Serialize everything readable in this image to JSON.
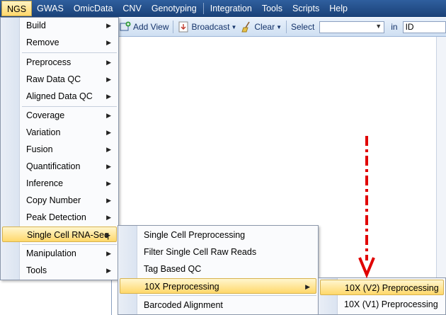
{
  "menubar": {
    "items": [
      "NGS",
      "GWAS",
      "OmicData",
      "CNV",
      "Genotyping",
      "Integration",
      "Tools",
      "Scripts",
      "Help"
    ]
  },
  "toolbar": {
    "add_view": "Add View",
    "broadcast": "Broadcast",
    "clear": "Clear",
    "select_label": "Select",
    "select_value": "",
    "in_label": "in",
    "in_value": "ID"
  },
  "ngs_menu": {
    "items": [
      "Build",
      "Remove",
      "Preprocess",
      "Raw Data QC",
      "Aligned Data QC",
      "Coverage",
      "Variation",
      "Fusion",
      "Quantification",
      "Inference",
      "Copy Number",
      "Peak Detection",
      "Single Cell RNA-Seq",
      "Manipulation",
      "Tools"
    ]
  },
  "scrna_menu": {
    "items": [
      "Single Cell Preprocessing",
      "Filter Single Cell Raw Reads",
      "Tag Based QC",
      "10X Preprocessing",
      "Barcoded Alignment"
    ]
  },
  "tenx_menu": {
    "items": [
      "10X (V2) Preprocessing",
      "10X (V1) Preprocessing"
    ]
  },
  "colors": {
    "menubar": "#1a4177",
    "highlight": "#ffd86a",
    "annotation_arrow": "#e00000"
  }
}
